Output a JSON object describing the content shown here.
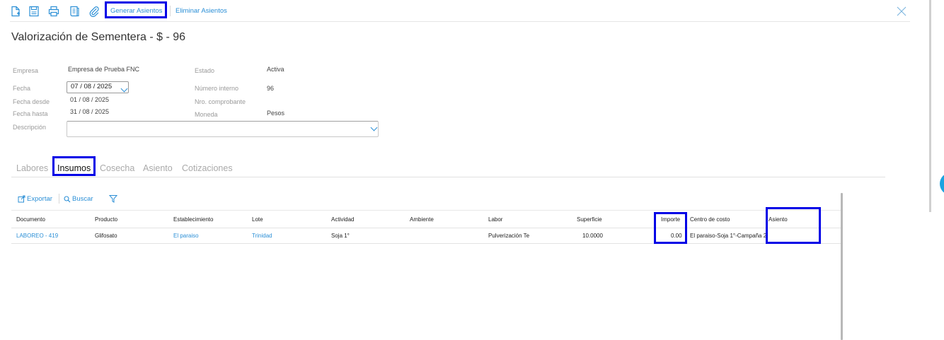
{
  "toolbar": {
    "icons": [
      "new-document-icon",
      "save-icon",
      "print-icon",
      "report-icon",
      "attachment-icon"
    ],
    "generar_label": "Generar Asientos",
    "eliminar_label": "Eliminar Asientos",
    "close_icon": "close-icon"
  },
  "page": {
    "title": "Valorización de Sementera - $ - 96"
  },
  "form": {
    "empresa_label": "Empresa",
    "empresa_value": "Empresa de Prueba FNC",
    "estado_label": "Estado",
    "estado_value": "Activa",
    "fecha_label": "Fecha",
    "fecha_value": "07 / 08 /  2025",
    "numero_interno_label": "Número interno",
    "numero_interno_value": "96",
    "fecha_desde_label": "Fecha desde",
    "fecha_desde_value": "01 / 08 /  2025",
    "nro_comprobante_label": "Nro. comprobante",
    "nro_comprobante_value": "",
    "fecha_hasta_label": "Fecha hasta",
    "fecha_hasta_value": "31 / 08 /  2025",
    "moneda_label": "Moneda",
    "moneda_value": "Pesos",
    "descripcion_label": "Descripción",
    "descripcion_value": ""
  },
  "tabs": [
    "Labores",
    "Insumos",
    "Cosecha",
    "Asiento",
    "Cotizaciones"
  ],
  "grid_toolbar": {
    "exportar_label": "Exportar",
    "buscar_label": "Buscar"
  },
  "grid": {
    "columns": [
      "Documento",
      "Producto",
      "Establecimiento",
      "Lote",
      "Actividad",
      "Ambiente",
      "Labor",
      "Superficie",
      "Importe",
      "Centro de costo",
      "Asiento"
    ],
    "rows": [
      [
        "LABOREO - 419",
        "Glifosato",
        "El paraiso",
        "Trinidad",
        "Soja 1°",
        "",
        "Pulverización Te",
        "10.0000",
        "0.00",
        "El paraiso-Soja 1°-Campaña 2",
        ""
      ]
    ]
  },
  "colors": {
    "accent": "#2b8fd6",
    "highlight": "#0000e6"
  }
}
